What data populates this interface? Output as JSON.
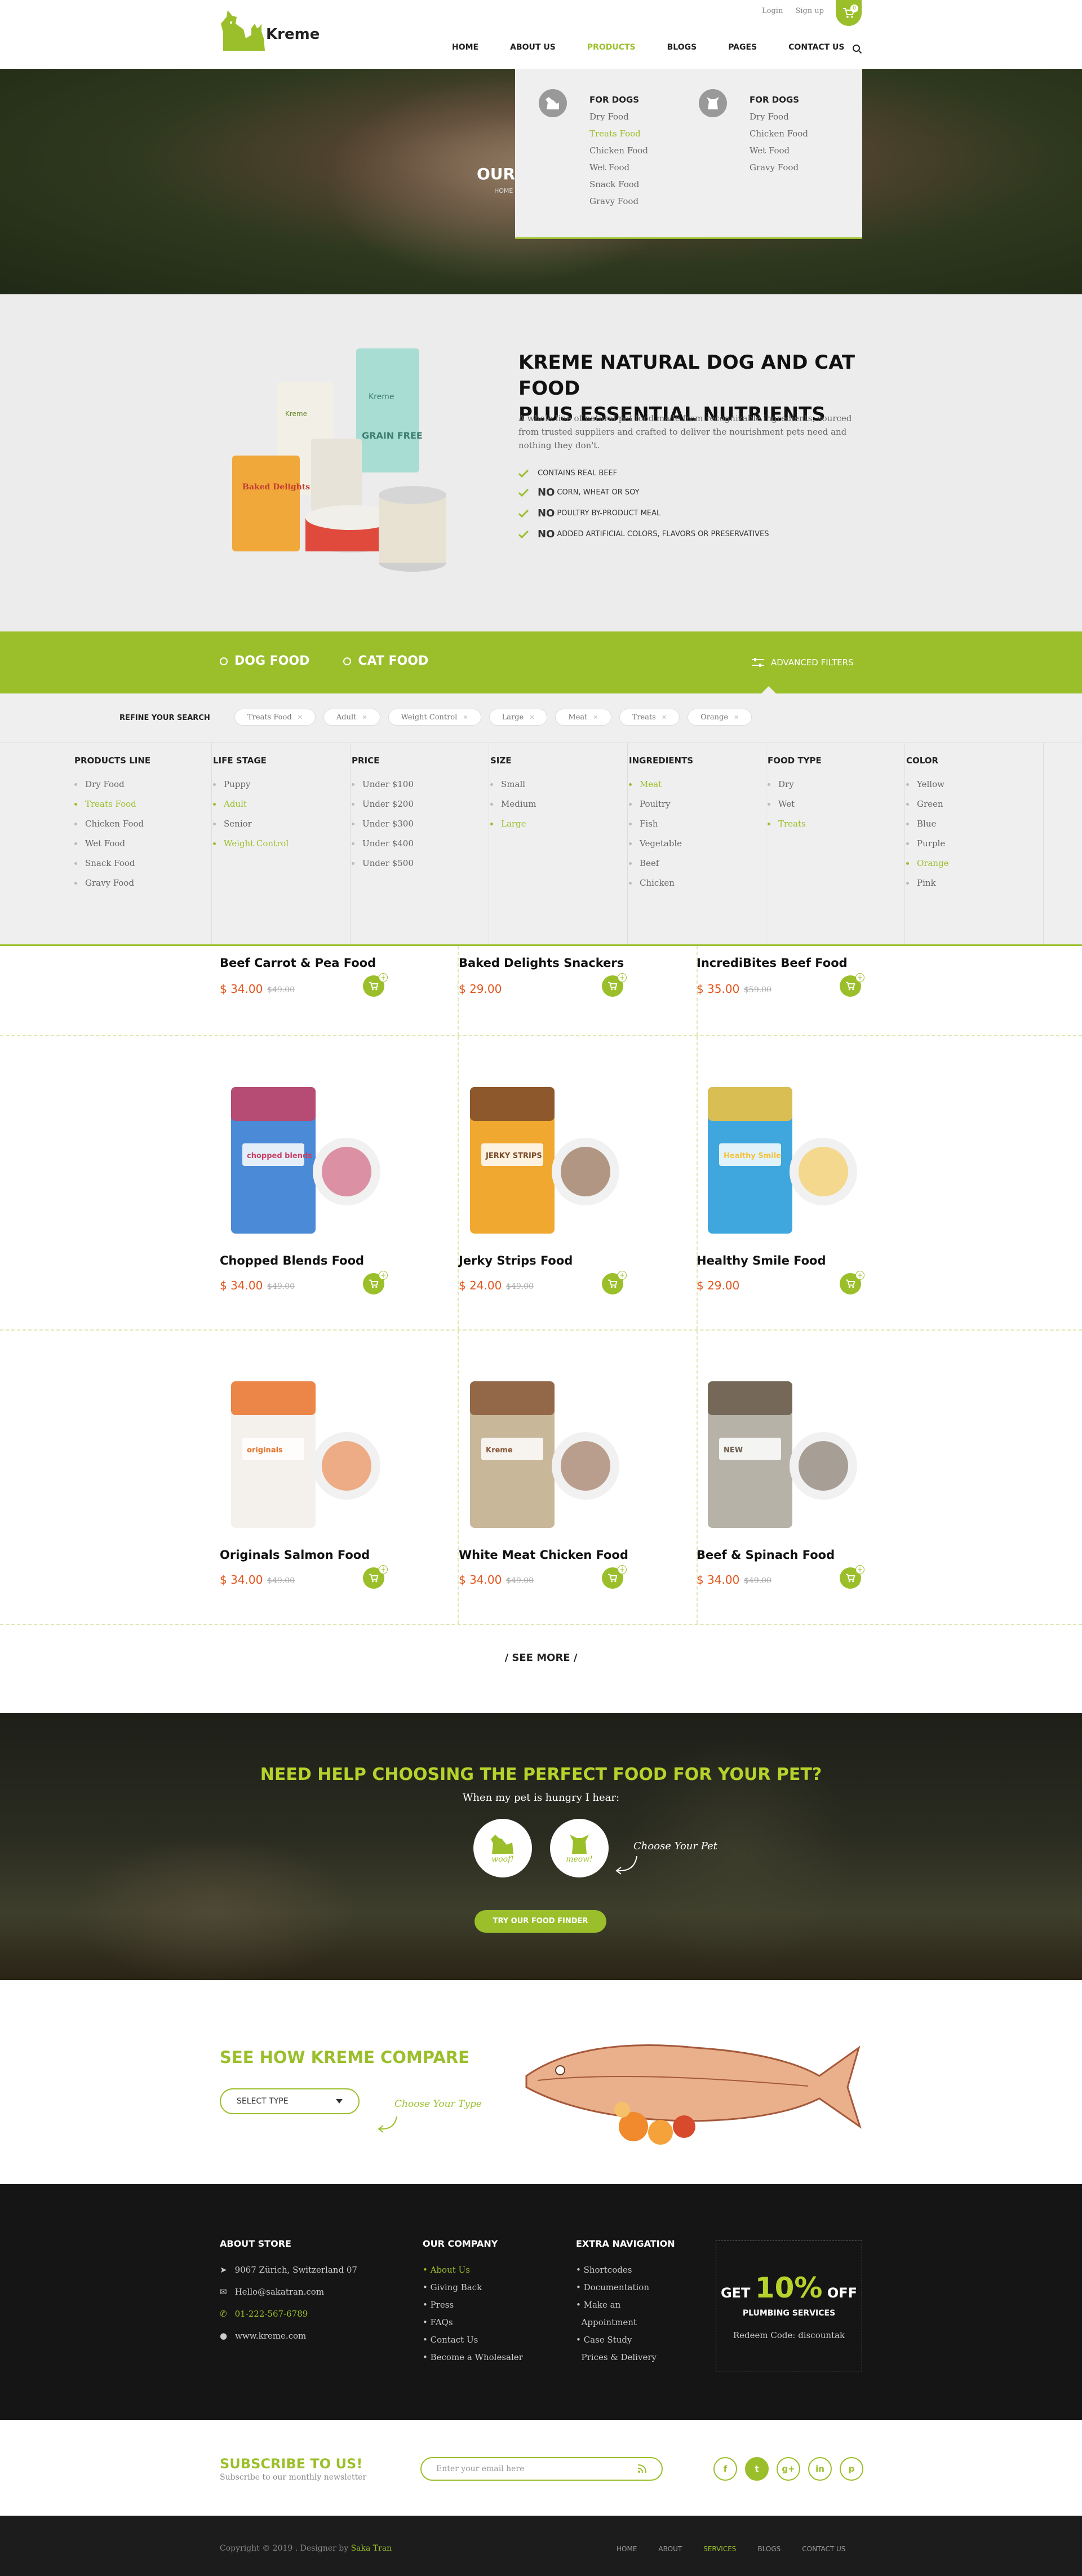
{
  "brand": {
    "name": "Kreme",
    "accent": "#9bbf2b",
    "price_color": "#e2541b"
  },
  "toplinks": {
    "login": "Login",
    "signup": "Sign up"
  },
  "cart": {
    "count": "0"
  },
  "nav": {
    "items": [
      "HOME",
      "ABOUT US",
      "PRODUCTS",
      "BLOGS",
      "PAGES",
      "CONTACT US"
    ],
    "active": "PRODUCTS"
  },
  "hero": {
    "title": "OUR",
    "crumb": "HOME"
  },
  "mega": {
    "columns": [
      {
        "title": "FOR DOGS",
        "icon": "dog-icon",
        "items": [
          "Dry Food",
          "Treats Food",
          "Chicken Food",
          "Wet Food",
          "Snack Food",
          "Gravy Food"
        ],
        "highlight": "Treats Food"
      },
      {
        "title": "FOR DOGS",
        "icon": "cat-icon",
        "items": [
          "Dry Food",
          "Chicken Food",
          "Wet Food",
          "Gravy Food"
        ],
        "highlight": ""
      }
    ]
  },
  "intro": {
    "title_line1": "KREME NATURAL DOG AND CAT FOOD",
    "title_line2": "PLUS ESSENTIAL NUTRIENTS",
    "desc": "A whole line of natural pet food made from recognizable ingredients, sourced from trusted suppliers and crafted to deliver the nourishment pets need and nothing they don't.",
    "points": [
      {
        "strong": "",
        "text": "CONTAINS REAL BEEF"
      },
      {
        "strong": "NO",
        "text": "CORN, WHEAT OR SOY"
      },
      {
        "strong": "NO",
        "text": "POULTRY BY-PRODUCT MEAL"
      },
      {
        "strong": "NO",
        "text": "ADDED ARTIFICIAL COLORS, FLAVORS OR PRESERVATIVES"
      }
    ],
    "packaging": {
      "grain_free": "GRAIN FREE",
      "brand": "Kreme",
      "baked": "Baked Delights"
    }
  },
  "filters": {
    "tabs": [
      "DOG FOOD",
      "CAT FOOD"
    ],
    "advanced": "ADVANCED FILTERS",
    "refine_label": "REFINE YOUR SEARCH",
    "chips": [
      "Treats Food",
      "Adult",
      "Weight Control",
      "Large",
      "Meat",
      "Treats",
      "Orange"
    ],
    "facets": [
      {
        "title": "PRODUCTS LINE",
        "items": [
          "Dry Food",
          "Treats Food",
          "Chicken Food",
          "Wet Food",
          "Snack Food",
          "Gravy Food"
        ],
        "on": [
          "Treats Food"
        ]
      },
      {
        "title": "LIFE STAGE",
        "items": [
          "Puppy",
          "Adult",
          "Senior",
          "Weight Control"
        ],
        "on": [
          "Adult",
          "Weight Control"
        ]
      },
      {
        "title": "PRICE",
        "items": [
          "Under $100",
          "Under $200",
          "Under $300",
          "Under $400",
          "Under $500"
        ],
        "on": []
      },
      {
        "title": "SIZE",
        "items": [
          "Small",
          "Medium",
          "Large"
        ],
        "on": [
          "Large"
        ]
      },
      {
        "title": "INGREDIENTS",
        "items": [
          "Meat",
          "Poultry",
          "Fish",
          "Vegetable",
          "Beef",
          "Chicken"
        ],
        "on": [
          "Meat"
        ]
      },
      {
        "title": "FOOD TYPE",
        "items": [
          "Dry",
          "Wet",
          "Treats"
        ],
        "on": [
          "Treats"
        ]
      },
      {
        "title": "COLOR",
        "items": [
          "Yellow",
          "Green",
          "Blue",
          "Purple",
          "Orange",
          "Pink"
        ],
        "on": [
          "Orange"
        ]
      }
    ]
  },
  "products": [
    {
      "name": "Beef Carrot & Pea Food",
      "price": "$ 34.00",
      "old": "$49.00"
    },
    {
      "name": "Baked Delights Snackers",
      "price": "$ 29.00",
      "old": ""
    },
    {
      "name": "IncrediBites Beef Food",
      "price": "$ 35.00",
      "old": "$59.00"
    },
    {
      "name": "Chopped Blends Food",
      "price": "$ 34.00",
      "old": "$49.00",
      "pack": "chopped blends"
    },
    {
      "name": "Jerky Strips Food",
      "price": "$ 24.00",
      "old": "$49.00",
      "pack": "JERKY STRIPS"
    },
    {
      "name": "Healthy Smile Food",
      "price": "$ 29.00",
      "old": "",
      "pack": "Healthy Smile"
    },
    {
      "name": "Originals Salmon Food",
      "price": "$ 34.00",
      "old": "$49.00",
      "pack": "originals"
    },
    {
      "name": "White Meat Chicken Food",
      "price": "$ 34.00",
      "old": "$49.00",
      "pack": "Kreme"
    },
    {
      "name": "Beef & Spinach Food",
      "price": "$ 34.00",
      "old": "$49.00",
      "pack": "NEW"
    }
  ],
  "see_more": "/ SEE MORE /",
  "help": {
    "title": "NEED HELP CHOOSING THE PERFECT FOOD FOR YOUR PET?",
    "sub": "When my pet is hungry I hear:",
    "bubbles": [
      "woof!",
      "meow!"
    ],
    "choose": "Choose Your Pet",
    "button": "TRY OUR FOOD FINDER"
  },
  "compare": {
    "title": "SEE HOW KREME COMPARE",
    "select": "SELECT TYPE",
    "choose": "Choose Your Type"
  },
  "footer": {
    "about_title": "ABOUT STORE",
    "address": "9067 Zürich, Switzerland 07",
    "email": "Hello@sakatran.com",
    "phone": "01-222-567-6789",
    "web": "www.kreme.com",
    "company_title": "OUR COMPANY",
    "company_links": [
      "About Us",
      "Giving Back",
      "Press",
      "FAQs",
      "Contact Us",
      "Become a Wholesaler"
    ],
    "extra_title": "EXTRA NAVIGATION",
    "extra_links": [
      "Shortcodes",
      "Documentation",
      "Make an",
      "Appointment",
      "Case Study",
      "Prices & Delivery"
    ],
    "promo_get": "GET",
    "promo_pct": "10%",
    "promo_off": "OFF",
    "promo_service": "PLUMBING SERVICES",
    "promo_code": "Redeem Code: discountak"
  },
  "newsletter": {
    "title": "SUBSCRIBE TO US!",
    "sub": "Subscribe to our monthly newsletter",
    "placeholder": "Enter your email here",
    "socials": [
      "f",
      "t",
      "g+",
      "in",
      "p"
    ]
  },
  "copyright": {
    "text": "Copyright © 2019 . Designer by",
    "author": "Saka Tran",
    "nav": [
      "HOME",
      "ABOUT",
      "SERVICES",
      "BLOGS",
      "CONTACT US"
    ],
    "active": "SERVICES"
  }
}
